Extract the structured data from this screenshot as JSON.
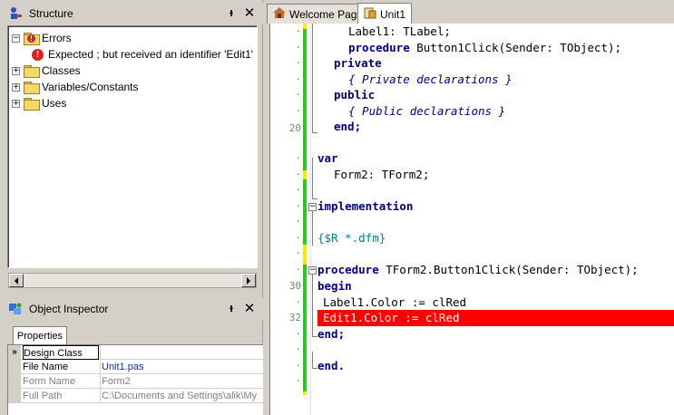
{
  "structure_panel": {
    "title": "Structure",
    "pin": "ᵼ",
    "close": "✕",
    "tree": {
      "errors_label": "Errors",
      "error_message": "Expected ; but received an identifier 'Edit1'",
      "items": [
        "Classes",
        "Variables/Constants",
        "Uses"
      ],
      "expand_glyph": "+",
      "collapse_glyph": "−",
      "error_glyph": "!"
    }
  },
  "object_inspector": {
    "title": "Object Inspector",
    "pin": "ᵼ",
    "close": "✕",
    "tab_label": "Properties",
    "expand_marker": "»",
    "rows": [
      {
        "name": "Design Class",
        "value": ""
      },
      {
        "name": "File Name",
        "value": "Unit1.pas"
      },
      {
        "name": "Form Name",
        "value": "Form2"
      },
      {
        "name": "Full Path",
        "value": "C:\\Documents and Settings\\alik\\My"
      }
    ]
  },
  "editor": {
    "tabs": [
      {
        "label": "Welcome Page"
      },
      {
        "label": "Unit1"
      }
    ],
    "line_numbers": {
      "line20": "20",
      "line30": "30",
      "line32": "32"
    },
    "code": {
      "l1": "Label1: TLabel;",
      "l2_kw": "procedure",
      "l2_rest": " Button1Click(Sender: TObject);",
      "l3": "private",
      "l4": "{ Private declarations }",
      "l5": "public",
      "l6": "{ Public declarations }",
      "l7": "end;",
      "l9": "var",
      "l10": "Form2: TForm2;",
      "l12": "implementation",
      "l14": "{$R *.dfm}",
      "l16_kw": "procedure",
      "l16_rest": " TForm2.Button1Click(Sender: TObject);",
      "l17": "begin",
      "l18": "Label1.Color := clRed",
      "l19": "Edit1.Color := clRed",
      "l20": "end;",
      "l22": "end."
    },
    "dot": "·",
    "fold_glyph": "−"
  },
  "colors": {
    "error_highlight": "#ff0000",
    "modified_bar": "#ffe600",
    "saved_bar": "#22cc22",
    "keyword": "#000080"
  }
}
